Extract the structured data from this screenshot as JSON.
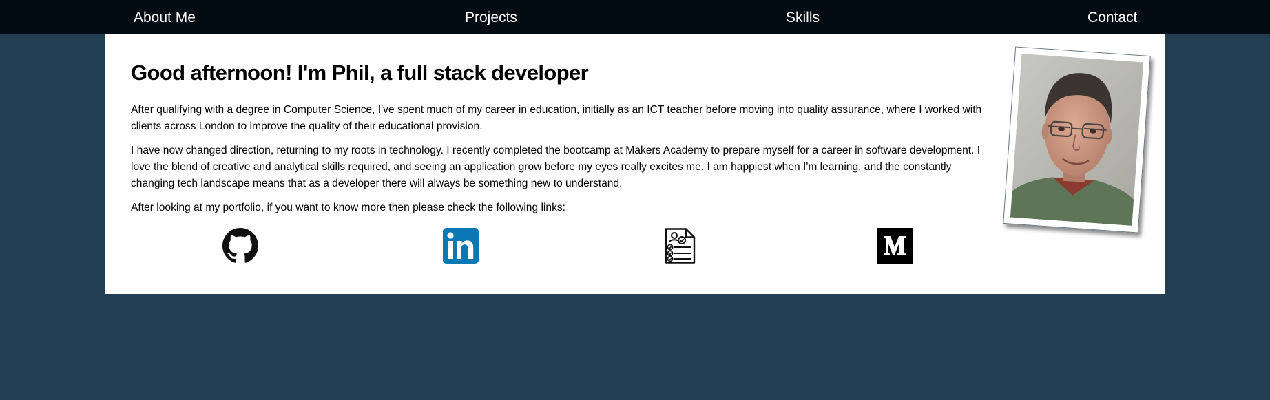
{
  "nav": {
    "items": [
      {
        "label": "About Me"
      },
      {
        "label": "Projects"
      },
      {
        "label": "Skills"
      },
      {
        "label": "Contact"
      }
    ]
  },
  "about": {
    "title": "Good afternoon! I'm Phil, a full stack developer",
    "paragraphs": [
      "After qualifying with a degree in Computer Science, I've spent much of my career in education, initially as an ICT teacher before moving into quality assurance, where I worked with clients across London to improve the quality of their educational provision.",
      "I have now changed direction, returning to my roots in technology. I recently completed the bootcamp at Makers Academy to prepare myself for a career in software development. I love the blend of creative and analytical skills required, and seeing an application grow before my eyes really excites me. I am happiest when I'm learning, and the constantly changing tech landscape means that as a developer there will always be something new to understand.",
      "After looking at my portfolio, if you want to know more then please check the following links:"
    ]
  },
  "links": [
    {
      "icon": "github-icon"
    },
    {
      "icon": "linkedin-icon"
    },
    {
      "icon": "cv-document-icon"
    },
    {
      "icon": "medium-icon"
    }
  ],
  "colors": {
    "page_background": "#233f54",
    "navbar_background": "#030c12",
    "nav_text": "#ffffff",
    "card_background": "#ffffff",
    "linkedin_blue": "#0a78b5"
  }
}
